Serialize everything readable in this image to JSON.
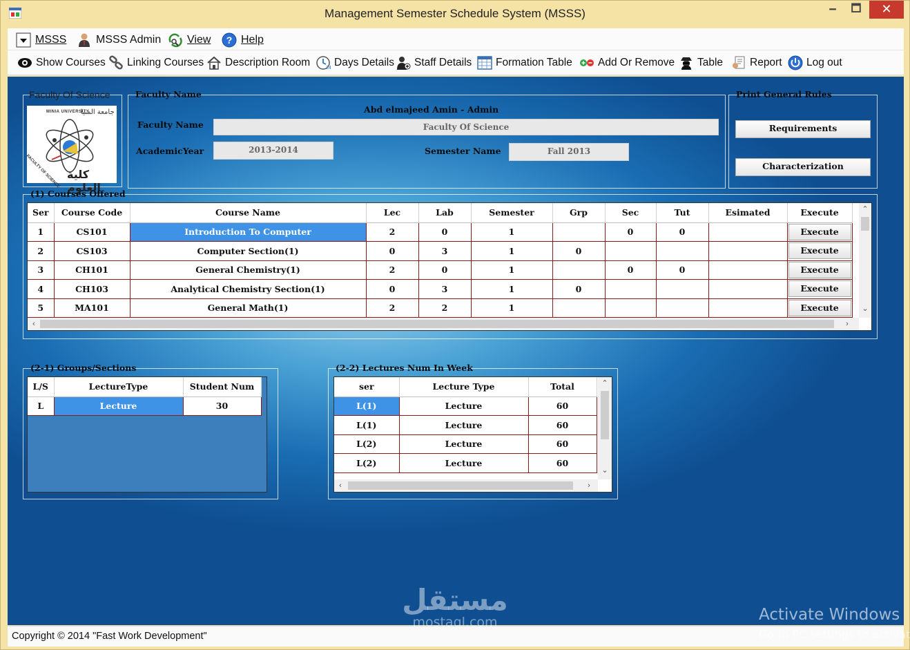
{
  "window": {
    "title": "Management Semester Schedule System (MSSS)",
    "controls": {
      "minimize": "🗕",
      "maximize": "🗖",
      "close": "✕"
    }
  },
  "menu": {
    "items": [
      {
        "label": "MSSS",
        "icon": "dropdown-box-icon"
      },
      {
        "label": "MSSS Admin",
        "icon": "admin-person-icon"
      },
      {
        "label": "View",
        "icon": "view-recycle-icon"
      },
      {
        "label": "Help",
        "icon": "help-circle-icon"
      }
    ]
  },
  "toolbar": {
    "items": [
      {
        "label": "Show Courses",
        "icon": "eye-icon"
      },
      {
        "label": "Linking Courses",
        "icon": "link-icon"
      },
      {
        "label": "Description Room",
        "icon": "house-icon"
      },
      {
        "label": "Days Details",
        "icon": "clock-calendar-icon"
      },
      {
        "label": "Staff Details",
        "icon": "staff-icon"
      },
      {
        "label": "Formation Table",
        "icon": "table-grid-icon"
      },
      {
        "label": "Add Or Remove",
        "icon": "add-remove-icon"
      },
      {
        "label": "Table",
        "icon": "spy-icon"
      },
      {
        "label": "Report",
        "icon": "report-icon"
      },
      {
        "label": "Log out",
        "icon": "logout-icon"
      }
    ]
  },
  "faculty_logo": {
    "title": "Faculty Of Science",
    "logo_text_arabic": "كلية العلوم",
    "logo_text_top": "جامعة المنيا",
    "logo_text_ring": "FACULTY OF SCIENCE",
    "logo_text_univ": "MINIA UNIVERSITY"
  },
  "faculty_name_panel": {
    "title": "Faculty Name",
    "admin_line": "Abd elmajeed Amin - Admin",
    "faculty_label": "Faculty Name",
    "faculty_value": "Faculty Of Science",
    "year_label": "AcademicYear",
    "year_value": "2013-2014",
    "semester_label": "Semester Name",
    "semester_value": "Fall 2013"
  },
  "print_rules": {
    "title": "Print General Rules",
    "requirements_btn": "Requirements",
    "characterization_btn": "Characterization"
  },
  "courses_offered": {
    "title": "(1) Courses Offered",
    "columns": [
      "Ser",
      "Course Code",
      "Course Name",
      "Lec",
      "Lab",
      "Semester",
      "Grp",
      "Sec",
      "Tut",
      "Esimated",
      "Execute"
    ],
    "rows": [
      {
        "ser": "1",
        "code": "CS101",
        "name": "Introduction To Computer",
        "lec": "2",
        "lab": "0",
        "semester": "1",
        "grp": "",
        "sec": "0",
        "tut": "0",
        "est": "",
        "execute": "Execute"
      },
      {
        "ser": "2",
        "code": "CS103",
        "name": "Computer Section(1)",
        "lec": "0",
        "lab": "3",
        "semester": "1",
        "grp": "0",
        "sec": "",
        "tut": "",
        "est": "",
        "execute": "Execute"
      },
      {
        "ser": "3",
        "code": "CH101",
        "name": "General Chemistry(1)",
        "lec": "2",
        "lab": "0",
        "semester": "1",
        "grp": "",
        "sec": "0",
        "tut": "0",
        "est": "",
        "execute": "Execute"
      },
      {
        "ser": "4",
        "code": "CH103",
        "name": "Analytical Chemistry Section(1)",
        "lec": "0",
        "lab": "3",
        "semester": "1",
        "grp": "0",
        "sec": "",
        "tut": "",
        "est": "",
        "execute": "Execute"
      },
      {
        "ser": "5",
        "code": "MA101",
        "name": "General Math(1)",
        "lec": "2",
        "lab": "2",
        "semester": "1",
        "grp": "",
        "sec": "",
        "tut": "",
        "est": "",
        "execute": "Execute"
      }
    ]
  },
  "groups_sections": {
    "title": "(2-1) Groups/Sections",
    "columns": [
      "L/S",
      "LectureType",
      "Student Num"
    ],
    "rows": [
      {
        "ls": "L",
        "type": "Lecture",
        "num": "30"
      }
    ]
  },
  "lectures_week": {
    "title": "(2-2) Lectures Num In Week",
    "columns": [
      "ser",
      "Lecture Type",
      "Total"
    ],
    "rows": [
      {
        "ser": "L(1)",
        "type": "Lecture",
        "total": "60"
      },
      {
        "ser": "L(1)",
        "type": "Lecture",
        "total": "60"
      },
      {
        "ser": "L(2)",
        "type": "Lecture",
        "total": "60"
      },
      {
        "ser": "L(2)",
        "type": "Lecture",
        "total": "60"
      }
    ]
  },
  "status": {
    "copyright": "Copyright © 2014 \"Fast Work Development\""
  },
  "overlay": {
    "watermark_ar": "مستقل",
    "watermark_en": "mostaql.com",
    "activate_title": "Activate Windows",
    "activate_sub": "Go to PC settings to activate"
  },
  "colors": {
    "frame": "#f5e3a6",
    "selection": "#3f93e6",
    "grid_line": "#8a1a1a",
    "close_button": "#c7392d"
  }
}
